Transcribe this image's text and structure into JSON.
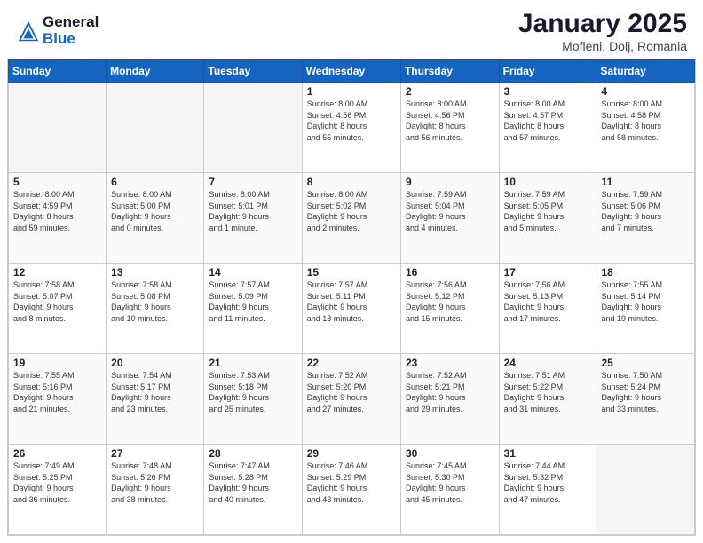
{
  "header": {
    "logo_general": "General",
    "logo_blue": "Blue",
    "title": "January 2025",
    "location": "Mofleni, Dolj, Romania"
  },
  "days_of_week": [
    "Sunday",
    "Monday",
    "Tuesday",
    "Wednesday",
    "Thursday",
    "Friday",
    "Saturday"
  ],
  "weeks": [
    [
      {
        "day": "",
        "info": ""
      },
      {
        "day": "",
        "info": ""
      },
      {
        "day": "",
        "info": ""
      },
      {
        "day": "1",
        "info": "Sunrise: 8:00 AM\nSunset: 4:56 PM\nDaylight: 8 hours\nand 55 minutes."
      },
      {
        "day": "2",
        "info": "Sunrise: 8:00 AM\nSunset: 4:56 PM\nDaylight: 8 hours\nand 56 minutes."
      },
      {
        "day": "3",
        "info": "Sunrise: 8:00 AM\nSunset: 4:57 PM\nDaylight: 8 hours\nand 57 minutes."
      },
      {
        "day": "4",
        "info": "Sunrise: 8:00 AM\nSunset: 4:58 PM\nDaylight: 8 hours\nand 58 minutes."
      }
    ],
    [
      {
        "day": "5",
        "info": "Sunrise: 8:00 AM\nSunset: 4:59 PM\nDaylight: 8 hours\nand 59 minutes."
      },
      {
        "day": "6",
        "info": "Sunrise: 8:00 AM\nSunset: 5:00 PM\nDaylight: 9 hours\nand 0 minutes."
      },
      {
        "day": "7",
        "info": "Sunrise: 8:00 AM\nSunset: 5:01 PM\nDaylight: 9 hours\nand 1 minute."
      },
      {
        "day": "8",
        "info": "Sunrise: 8:00 AM\nSunset: 5:02 PM\nDaylight: 9 hours\nand 2 minutes."
      },
      {
        "day": "9",
        "info": "Sunrise: 7:59 AM\nSunset: 5:04 PM\nDaylight: 9 hours\nand 4 minutes."
      },
      {
        "day": "10",
        "info": "Sunrise: 7:59 AM\nSunset: 5:05 PM\nDaylight: 9 hours\nand 5 minutes."
      },
      {
        "day": "11",
        "info": "Sunrise: 7:59 AM\nSunset: 5:06 PM\nDaylight: 9 hours\nand 7 minutes."
      }
    ],
    [
      {
        "day": "12",
        "info": "Sunrise: 7:58 AM\nSunset: 5:07 PM\nDaylight: 9 hours\nand 8 minutes."
      },
      {
        "day": "13",
        "info": "Sunrise: 7:58 AM\nSunset: 5:08 PM\nDaylight: 9 hours\nand 10 minutes."
      },
      {
        "day": "14",
        "info": "Sunrise: 7:57 AM\nSunset: 5:09 PM\nDaylight: 9 hours\nand 11 minutes."
      },
      {
        "day": "15",
        "info": "Sunrise: 7:57 AM\nSunset: 5:11 PM\nDaylight: 9 hours\nand 13 minutes."
      },
      {
        "day": "16",
        "info": "Sunrise: 7:56 AM\nSunset: 5:12 PM\nDaylight: 9 hours\nand 15 minutes."
      },
      {
        "day": "17",
        "info": "Sunrise: 7:56 AM\nSunset: 5:13 PM\nDaylight: 9 hours\nand 17 minutes."
      },
      {
        "day": "18",
        "info": "Sunrise: 7:55 AM\nSunset: 5:14 PM\nDaylight: 9 hours\nand 19 minutes."
      }
    ],
    [
      {
        "day": "19",
        "info": "Sunrise: 7:55 AM\nSunset: 5:16 PM\nDaylight: 9 hours\nand 21 minutes."
      },
      {
        "day": "20",
        "info": "Sunrise: 7:54 AM\nSunset: 5:17 PM\nDaylight: 9 hours\nand 23 minutes."
      },
      {
        "day": "21",
        "info": "Sunrise: 7:53 AM\nSunset: 5:18 PM\nDaylight: 9 hours\nand 25 minutes."
      },
      {
        "day": "22",
        "info": "Sunrise: 7:52 AM\nSunset: 5:20 PM\nDaylight: 9 hours\nand 27 minutes."
      },
      {
        "day": "23",
        "info": "Sunrise: 7:52 AM\nSunset: 5:21 PM\nDaylight: 9 hours\nand 29 minutes."
      },
      {
        "day": "24",
        "info": "Sunrise: 7:51 AM\nSunset: 5:22 PM\nDaylight: 9 hours\nand 31 minutes."
      },
      {
        "day": "25",
        "info": "Sunrise: 7:50 AM\nSunset: 5:24 PM\nDaylight: 9 hours\nand 33 minutes."
      }
    ],
    [
      {
        "day": "26",
        "info": "Sunrise: 7:49 AM\nSunset: 5:25 PM\nDaylight: 9 hours\nand 36 minutes."
      },
      {
        "day": "27",
        "info": "Sunrise: 7:48 AM\nSunset: 5:26 PM\nDaylight: 9 hours\nand 38 minutes."
      },
      {
        "day": "28",
        "info": "Sunrise: 7:47 AM\nSunset: 5:28 PM\nDaylight: 9 hours\nand 40 minutes."
      },
      {
        "day": "29",
        "info": "Sunrise: 7:46 AM\nSunset: 5:29 PM\nDaylight: 9 hours\nand 43 minutes."
      },
      {
        "day": "30",
        "info": "Sunrise: 7:45 AM\nSunset: 5:30 PM\nDaylight: 9 hours\nand 45 minutes."
      },
      {
        "day": "31",
        "info": "Sunrise: 7:44 AM\nSunset: 5:32 PM\nDaylight: 9 hours\nand 47 minutes."
      },
      {
        "day": "",
        "info": ""
      }
    ]
  ]
}
